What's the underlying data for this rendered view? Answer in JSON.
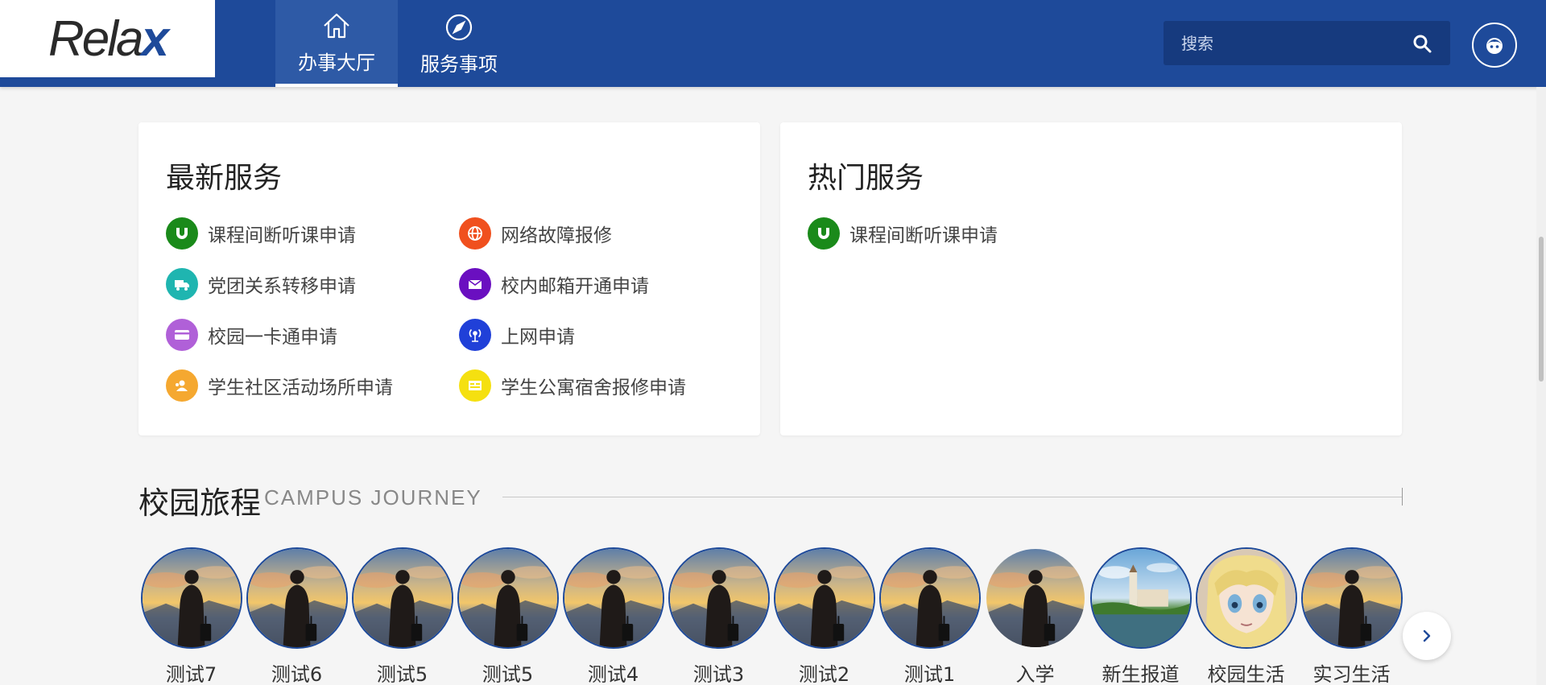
{
  "logo": {
    "text_main": "Rela",
    "text_accent": "x"
  },
  "nav": [
    {
      "label": "办事大厅",
      "icon": "home-icon",
      "active": true
    },
    {
      "label": "服务事项",
      "icon": "compass-icon",
      "active": false
    }
  ],
  "search": {
    "placeholder": "搜索",
    "icon": "search-icon"
  },
  "user": {
    "icon": "avatar-icon"
  },
  "latest": {
    "title": "最新服务",
    "items": [
      {
        "label": "课程间断听课申请",
        "icon": "magnet-icon",
        "color": "#1a8a1a"
      },
      {
        "label": "网络故障报修",
        "icon": "globe-icon",
        "color": "#f0501e"
      },
      {
        "label": "党团关系转移申请",
        "icon": "truck-icon",
        "color": "#1fb5b0"
      },
      {
        "label": "校内邮箱开通申请",
        "icon": "mail-icon",
        "color": "#6a0fc0"
      },
      {
        "label": "校园一卡通申请",
        "icon": "card-icon",
        "color": "#b060d8"
      },
      {
        "label": "上网申请",
        "icon": "wifi-tower-icon",
        "color": "#2040d8"
      },
      {
        "label": "学生社区活动场所申请",
        "icon": "people-icon",
        "color": "#f5a830"
      },
      {
        "label": "学生公寓宿舍报修申请",
        "icon": "dorm-icon",
        "color": "#f5e010"
      }
    ]
  },
  "hot": {
    "title": "热门服务",
    "items": [
      {
        "label": "课程间断听课申请",
        "icon": "magnet-icon",
        "color": "#1a8a1a"
      }
    ]
  },
  "journey": {
    "title": "校园旅程",
    "subtitle": "CAMPUS JOURNEY",
    "items": [
      {
        "label": "测试7",
        "image": "traveler-sunset"
      },
      {
        "label": "测试6",
        "image": "traveler-sunset"
      },
      {
        "label": "测试5",
        "image": "traveler-sunset"
      },
      {
        "label": "测试5",
        "image": "traveler-sunset"
      },
      {
        "label": "测试4",
        "image": "traveler-sunset"
      },
      {
        "label": "测试3",
        "image": "traveler-sunset"
      },
      {
        "label": "测试2",
        "image": "traveler-sunset"
      },
      {
        "label": "测试1",
        "image": "traveler-sunset"
      },
      {
        "label": "入学",
        "image": "traveler-sunset"
      },
      {
        "label": "新生报道",
        "image": "campus-lake"
      },
      {
        "label": "校园生活",
        "image": "anime-character"
      },
      {
        "label": "实习生活",
        "image": "traveler-sunset"
      }
    ],
    "next_icon": "chevron-right-icon"
  },
  "colors": {
    "header": "#1e4a9a",
    "accent": "#1e4a9a"
  }
}
